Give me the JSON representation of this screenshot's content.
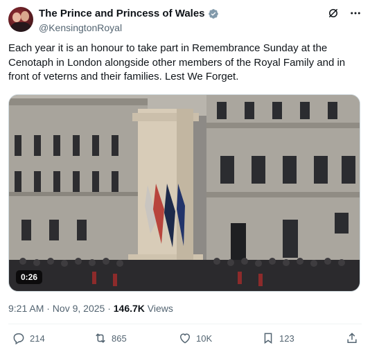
{
  "account": {
    "display_name": "The Prince and Princess of Wales",
    "handle": "@KensingtonRoyal",
    "verified_color": "#829aab"
  },
  "header_icons": [
    "grok-icon",
    "more-options-icon"
  ],
  "tweet": {
    "text": "Each year it is an honour to take part in Remembrance Sunday at the Cenotaph in London alongside other members of the Royal Family and in front of veterns and their families. Lest We Forget."
  },
  "media": {
    "video_duration": "0:26"
  },
  "meta": {
    "timestamp": "9:21 AM · Nov 9, 2025",
    "separator": " · ",
    "views_count": "146.7K",
    "views_label": " Views"
  },
  "actions": {
    "replies": "214",
    "reposts": "865",
    "likes": "10K",
    "bookmarks": "123"
  },
  "colors": {
    "text_primary": "#0f1419",
    "text_secondary": "#536471",
    "border": "#cfd9de"
  }
}
